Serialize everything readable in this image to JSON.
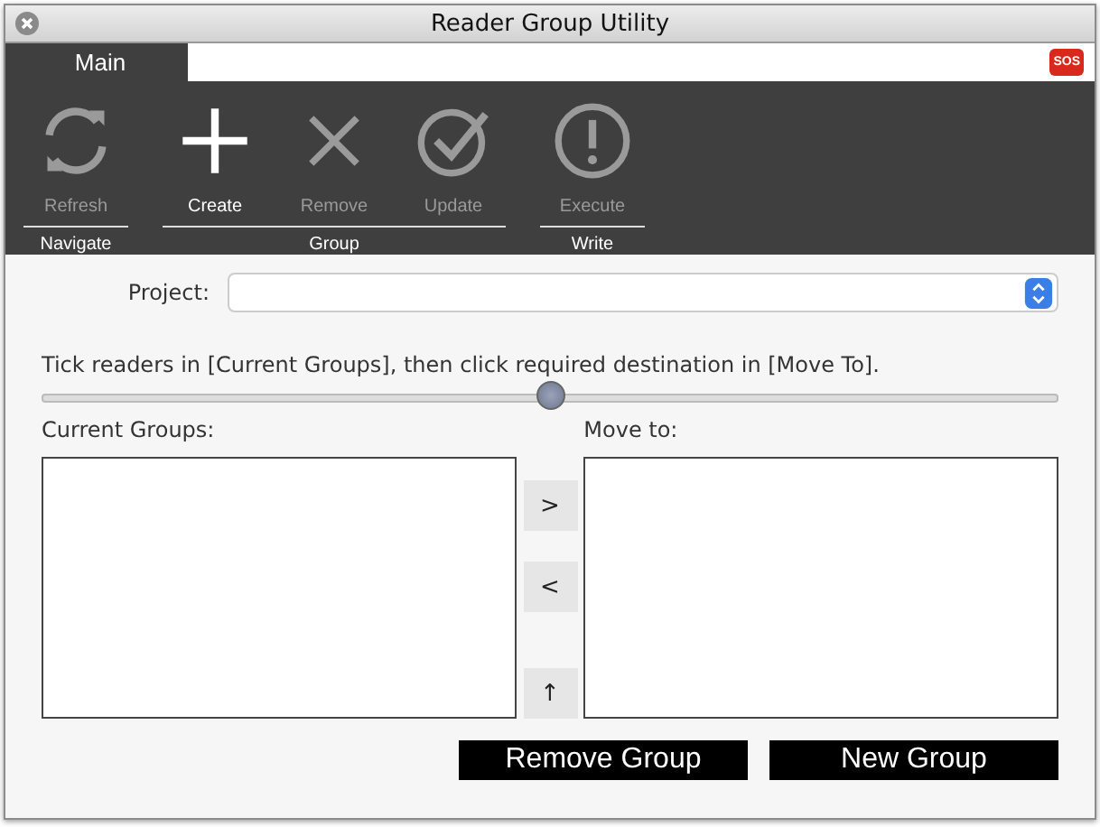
{
  "window": {
    "title": "Reader Group Utility"
  },
  "tabs": [
    {
      "label": "Main",
      "selected": true
    }
  ],
  "help_badge": "SOS",
  "toolbar_groups": [
    {
      "label": "Navigate",
      "buttons": [
        {
          "label": "Refresh",
          "kind": "refresh",
          "disabled": true
        }
      ]
    },
    {
      "label": "Group",
      "buttons": [
        {
          "label": "Create",
          "kind": "create",
          "disabled": false
        },
        {
          "label": "Remove",
          "kind": "remove",
          "disabled": true
        },
        {
          "label": "Update",
          "kind": "update",
          "disabled": true
        }
      ]
    },
    {
      "label": "Write",
      "buttons": [
        {
          "label": "Execute",
          "kind": "execute",
          "disabled": true
        }
      ]
    }
  ],
  "project": {
    "label": "Project:"
  },
  "instruction": "Tick readers in [Current Groups], then click required destination in [Move To].",
  "splitter": {
    "level": 0.5
  },
  "current_groups": {
    "label": "Current Groups:"
  },
  "move_to": {
    "label": "Move to:"
  },
  "move_buttons": [
    ">",
    "<",
    "↑"
  ],
  "buttons": [
    "Remove Group",
    "New Group"
  ]
}
